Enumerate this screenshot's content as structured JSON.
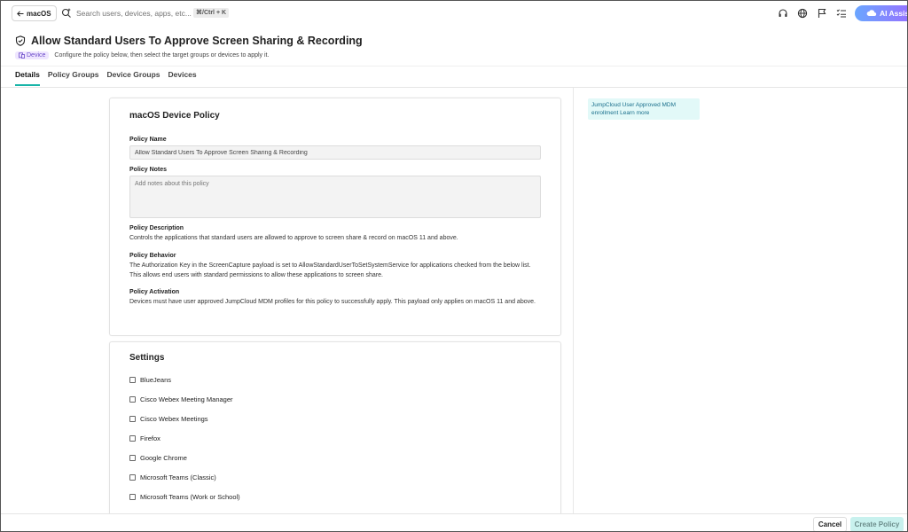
{
  "topbar": {
    "back_label": "macOS",
    "search_placeholder": "Search users, devices, apps, etc...",
    "shortcut": "⌘/Ctrl + K",
    "ai_label": "AI Assist"
  },
  "header": {
    "title": "Allow Standard Users To Approve Screen Sharing & Recording",
    "badge": "Device",
    "subtitle": "Configure the policy below, then select the target groups or devices to apply it."
  },
  "tabs": [
    {
      "label": "Details",
      "active": true
    },
    {
      "label": "Policy Groups",
      "active": false
    },
    {
      "label": "Device Groups",
      "active": false
    },
    {
      "label": "Devices",
      "active": false
    }
  ],
  "policy_card": {
    "title": "macOS Device Policy",
    "name_label": "Policy Name",
    "name_value": "Allow Standard Users To Approve Screen Sharing & Recording",
    "notes_label": "Policy Notes",
    "notes_placeholder": "Add notes about this policy",
    "description_label": "Policy Description",
    "description_text": "Controls the applications that standard users are allowed to approve to screen share & record on macOS 11 and above.",
    "behavior_label": "Policy Behavior",
    "behavior_text": "The Authorization Key in the ScreenCapture payload is set to AllowStandardUserToSetSystemService for applications checked from the below list. This allows end users with standard permissions to allow these applications to screen share.",
    "activation_label": "Policy Activation",
    "activation_text": "Devices must have user approved JumpCloud MDM profiles for this policy to successfully apply. This payload only applies on macOS 11 and above."
  },
  "settings_card": {
    "title": "Settings",
    "items": [
      {
        "label": "BlueJeans",
        "checked": false
      },
      {
        "label": "Cisco Webex Meeting Manager",
        "checked": false
      },
      {
        "label": "Cisco Webex Meetings",
        "checked": false
      },
      {
        "label": "Firefox",
        "checked": false
      },
      {
        "label": "Google Chrome",
        "checked": false
      },
      {
        "label": "Microsoft Teams (Classic)",
        "checked": false
      },
      {
        "label": "Microsoft Teams (Work or School)",
        "checked": false
      }
    ]
  },
  "info_box": {
    "text": "JumpCloud User Approved MDM enrollment",
    "link": "Learn more"
  },
  "footer": {
    "cancel_label": "Cancel",
    "create_label": "Create Policy"
  },
  "colors": {
    "accent": "#18b4a8",
    "badge_bg": "#efe6ff",
    "badge_text": "#6b4bc9",
    "info_bg": "#e2f9f8",
    "create_bg": "#c8f1ee"
  }
}
